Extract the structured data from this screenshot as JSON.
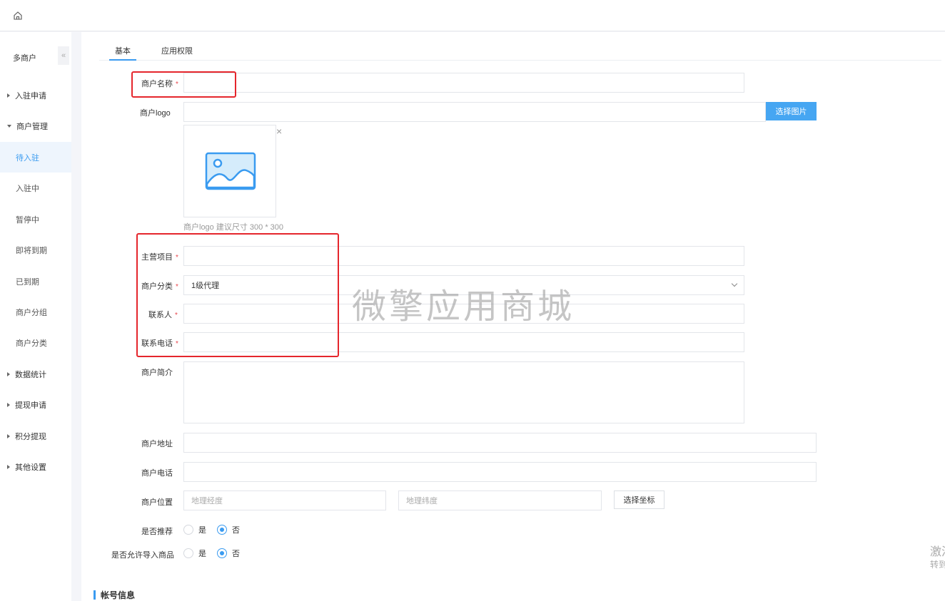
{
  "sidebar": {
    "title": "多商户",
    "collapse_glyph": "«",
    "items": [
      {
        "label": "入驻申请"
      },
      {
        "label": "商户管理"
      },
      {
        "label": "待入驻"
      },
      {
        "label": "入驻中"
      },
      {
        "label": "暂停中"
      },
      {
        "label": "即将到期"
      },
      {
        "label": "已到期"
      },
      {
        "label": "商户分组"
      },
      {
        "label": "商户分类"
      },
      {
        "label": "数据统计"
      },
      {
        "label": "提现申请"
      },
      {
        "label": "积分提现"
      },
      {
        "label": "其他设置"
      }
    ]
  },
  "tabs": [
    {
      "label": "基本"
    },
    {
      "label": "应用权限"
    }
  ],
  "form": {
    "name_label": "商户名称",
    "required_mark": "*",
    "logo_label": "商户logo",
    "choose_image_button": "选择图片",
    "close_glyph": "×",
    "logo_hint": "商户logo 建议尺寸 300 * 300",
    "main_project_label": "主营项目",
    "category_label": "商户分类",
    "category_value": "1级代理",
    "contact_label": "联系人",
    "contact_phone_label": "联系电话",
    "intro_label": "商户简介",
    "address_label": "商户地址",
    "phone_label": "商户电话",
    "location_label": "商户位置",
    "longitude_placeholder": "地理经度",
    "latitude_placeholder": "地理纬度",
    "choose_coord_button": "选择坐标",
    "recommend_label": "是否推荐",
    "allow_import_label": "是否允许导入商品",
    "yes": "是",
    "no": "否"
  },
  "section": {
    "account_title": "帐号信息"
  },
  "watermark": "微擎应用商城",
  "activation": {
    "line1": "激活",
    "line2": "转到"
  },
  "colors": {
    "accent": "#3a9bf0",
    "button_blue": "#46a6f2",
    "highlight_red": "#e5262c",
    "required_red": "#e8474d"
  }
}
